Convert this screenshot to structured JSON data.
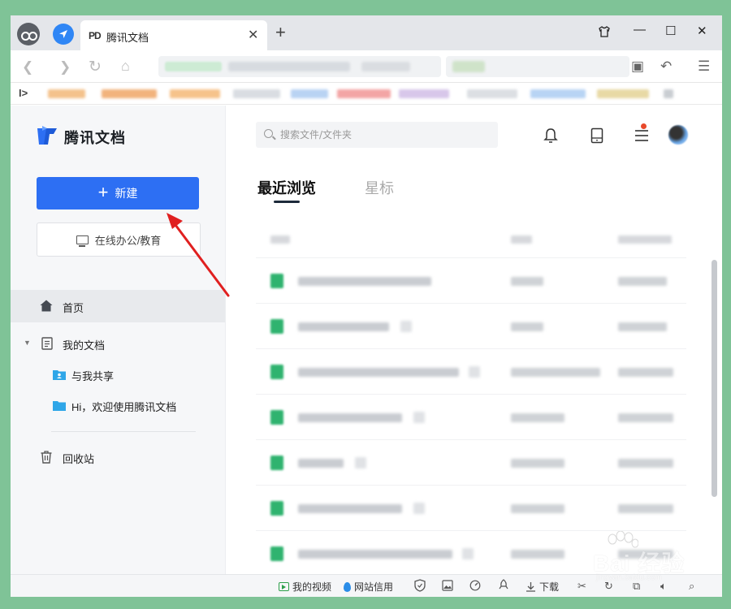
{
  "browser": {
    "tab_title": "腾讯文档",
    "tab_icon_text": "PD",
    "new_tab_symbol": "+",
    "close_symbol": "✕",
    "window_controls": [
      "⬚",
      "—",
      "☐",
      "✕"
    ]
  },
  "sidebar": {
    "logo_text": "腾讯文档",
    "new_button_label": "新建",
    "new_button_plus": "+",
    "edu_button_label": "在线办公/教育",
    "nav": {
      "home": "首页",
      "my_docs": "我的文档",
      "shared": "与我共享",
      "welcome": "Hi，欢迎使用腾讯文档",
      "trash": "回收站"
    }
  },
  "main": {
    "search_placeholder": "搜索文件/文件夹",
    "tabs": {
      "recent": "最近浏览",
      "starred": "星标"
    }
  },
  "statusbar": {
    "my_videos": "我的视频",
    "site_credit": "网站信用",
    "download": "下载"
  },
  "watermark": {
    "text": "Bai 经验",
    "sub": "jingyan.baidu.com"
  },
  "colors": {
    "accent": "#2d6ff3",
    "page_bg": "#7fc397",
    "arrow": "#e02020",
    "doc_icon": "#2fb36f",
    "notification_dot": "#e8492b"
  }
}
